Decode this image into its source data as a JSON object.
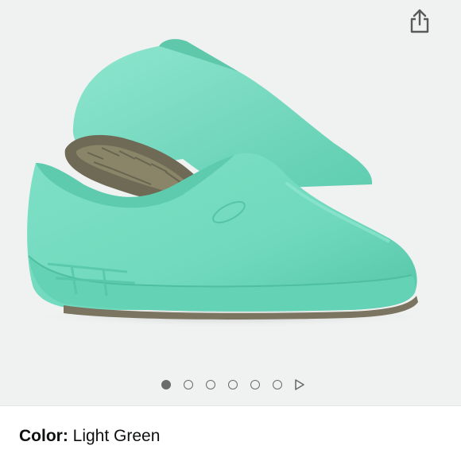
{
  "gallery": {
    "image_count": 6,
    "active_index": 0,
    "image": {
      "subject": "light-green slip-resistant clog pair",
      "shoe_color": "#74dcc0"
    },
    "share_icon": "share-icon",
    "play_icon": "play-triangle-icon"
  },
  "variation": {
    "label": "Color:",
    "value": "Light Green"
  },
  "colors": {
    "gallery_bg": "#f0f2f2",
    "shoe": "#74dcc0",
    "shoe_shadow": "#4fbf9f",
    "dot": "#6b6b6b",
    "text": "#0f1111"
  }
}
